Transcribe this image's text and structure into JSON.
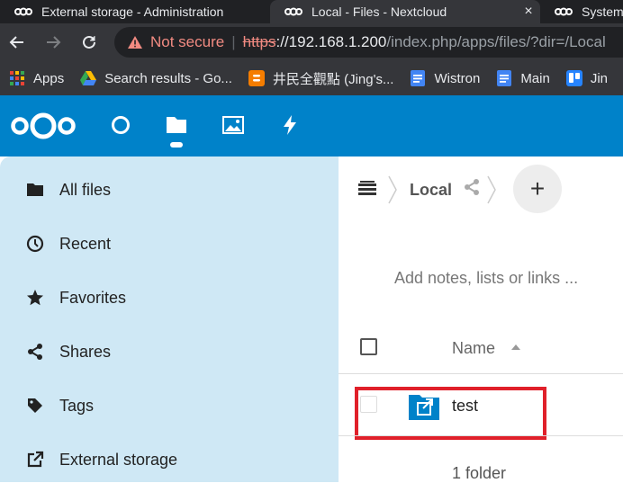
{
  "browser": {
    "tabs": [
      {
        "title": "External storage - Administration",
        "active": false
      },
      {
        "title": "Local - Files - Nextcloud",
        "active": true,
        "close": "×"
      },
      {
        "title": "System",
        "active": false
      }
    ],
    "address": {
      "warning": "Not secure",
      "separator": "|",
      "scheme": "https",
      "rest_host": "://192.168.1.200",
      "path": "/index.php/apps/files/?dir=/Local"
    },
    "bookmarks": [
      {
        "label": "Apps",
        "icon": "apps-grid-icon"
      },
      {
        "label": "Search results - Go...",
        "icon": "google-drive-icon"
      },
      {
        "label": "井民全觀點 (Jing's...",
        "icon": "blogger-icon"
      },
      {
        "label": "Wistron",
        "icon": "docs-icon"
      },
      {
        "label": "Main",
        "icon": "docs-icon"
      },
      {
        "label": "Jin",
        "icon": "trello-icon"
      }
    ]
  },
  "nextcloud": {
    "brand_color": "#0082c9",
    "apps": [
      "dashboard-icon",
      "files-icon",
      "photos-icon",
      "activity-icon"
    ],
    "sidebar": {
      "items": [
        {
          "label": "All files",
          "icon": "folder-icon"
        },
        {
          "label": "Recent",
          "icon": "clock-icon"
        },
        {
          "label": "Favorites",
          "icon": "star-icon"
        },
        {
          "label": "Shares",
          "icon": "share-icon"
        },
        {
          "label": "Tags",
          "icon": "tag-icon"
        },
        {
          "label": "External storage",
          "icon": "external-storage-icon"
        }
      ]
    },
    "main": {
      "breadcrumb_current": "Local",
      "add_label": "+",
      "notes_placeholder": "Add notes, lists or links ...",
      "column_name": "Name",
      "files": [
        {
          "name": "test",
          "type": "external-folder"
        }
      ],
      "summary": "1 folder"
    }
  }
}
